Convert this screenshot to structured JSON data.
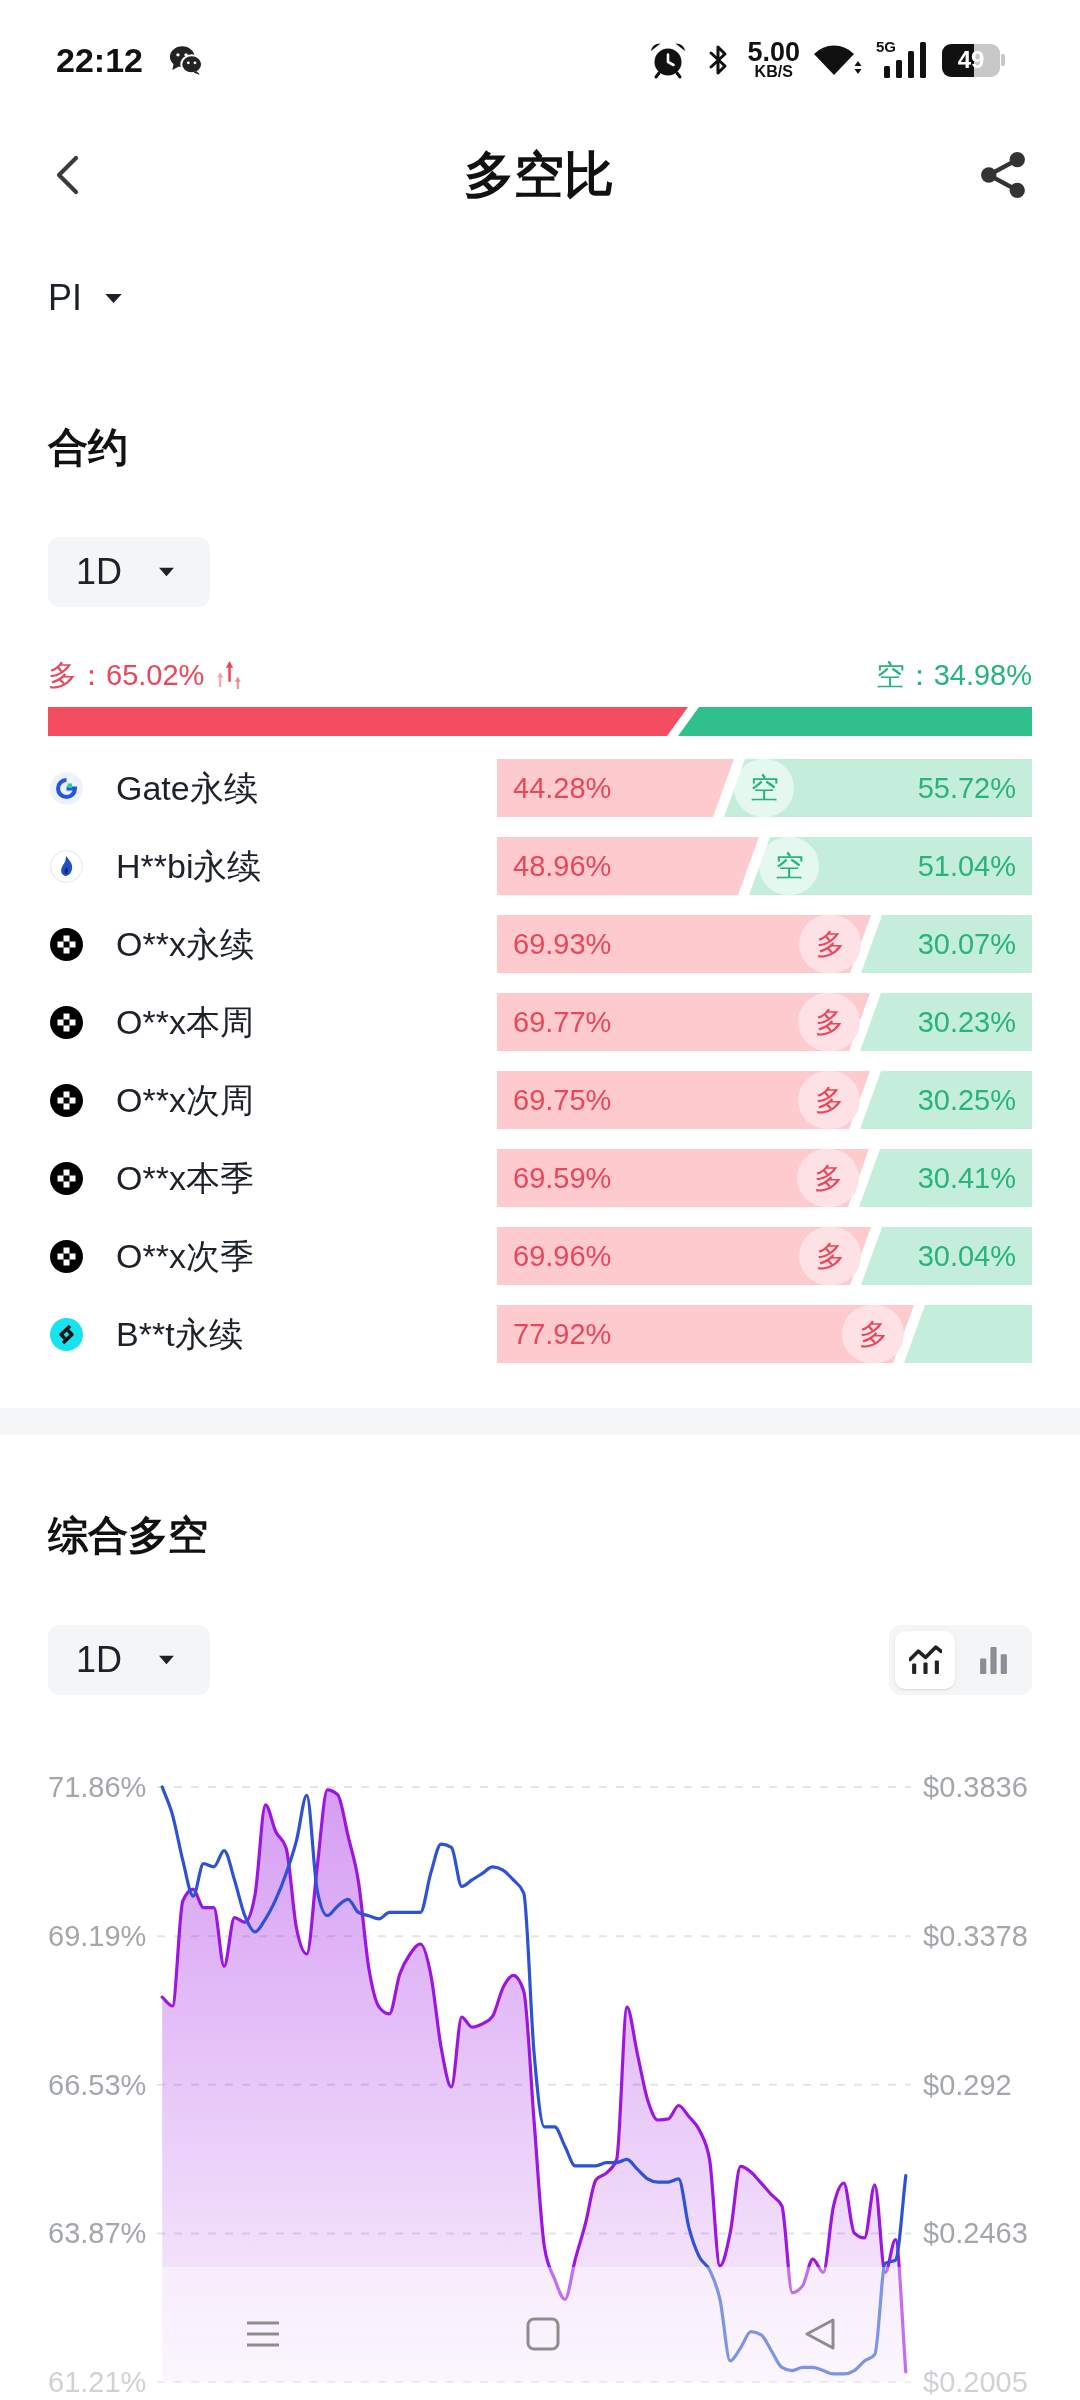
{
  "status_bar": {
    "time": "22:12",
    "network_speed": "5.00",
    "network_speed_unit": "KB/S",
    "network_type": "5G",
    "battery": "49"
  },
  "header": {
    "title": "多空比"
  },
  "symbol_selector": {
    "value": "PI"
  },
  "contracts": {
    "title": "合约",
    "period": "1D",
    "long_summary": "多：65.02%",
    "short_summary": "空：34.98%",
    "level": 0.6502,
    "exchanges": [
      {
        "kind": "ring",
        "name": "Gate永续",
        "long": "44.28%",
        "short": "55.72%",
        "level": 0.4428,
        "badge": "空"
      },
      {
        "kind": "flame",
        "name": "H**bi永续",
        "long": "48.96%",
        "short": "51.04%",
        "level": 0.4896,
        "badge": "空"
      },
      {
        "kind": "checker",
        "name": "O**x永续",
        "long": "69.93%",
        "short": "30.07%",
        "level": 0.6993,
        "badge": "多"
      },
      {
        "kind": "checker",
        "name": "O**x本周",
        "long": "69.77%",
        "short": "30.23%",
        "level": 0.6977,
        "badge": "多"
      },
      {
        "kind": "checker",
        "name": "O**x次周",
        "long": "69.75%",
        "short": "30.25%",
        "level": 0.6975,
        "badge": "多"
      },
      {
        "kind": "checker",
        "name": "O**x本季",
        "long": "69.59%",
        "short": "30.41%",
        "level": 0.6959,
        "badge": "多"
      },
      {
        "kind": "checker",
        "name": "O**x次季",
        "long": "69.96%",
        "short": "30.04%",
        "level": 0.6996,
        "badge": "多"
      },
      {
        "kind": "swirl",
        "name": "B**t永续",
        "long": "77.92%",
        "level": 0.7792,
        "badge": "多"
      }
    ]
  },
  "composite": {
    "title": "综合多空",
    "period": "1D",
    "chart_types": [
      {
        "kind": "line",
        "selected": true
      },
      {
        "kind": "bar",
        "selected": false
      }
    ],
    "chart_data": {
      "type": "line",
      "grid": true,
      "yticks": [
        {
          "value": 71.86,
          "label": "71.86%"
        },
        {
          "value": 69.19,
          "label": "69.19%"
        },
        {
          "value": 66.53,
          "label": "66.53%"
        },
        {
          "value": 63.87,
          "label": "63.87%"
        },
        {
          "value": 61.21,
          "label": "61.21%"
        }
      ],
      "ylim": [
        61.21,
        71.86
      ],
      "y2ticks": [
        {
          "value": 0.3836,
          "label": "$0.3836"
        },
        {
          "value": 0.3378,
          "label": "$0.3378"
        },
        {
          "value": 0.292,
          "label": "$0.292"
        },
        {
          "value": 0.2463,
          "label": "$0.2463"
        },
        {
          "value": 0.2005,
          "label": "$0.2005"
        }
      ],
      "y2lim": [
        0.2005,
        0.3836
      ],
      "series": [
        {
          "type": "area",
          "color": "#9c16e2",
          "values": [
            68.1,
            67.94,
            69.82,
            70.03,
            69.7,
            69.7,
            68.65,
            69.52,
            69.44,
            69.94,
            71.54,
            71.06,
            70.77,
            69.34,
            68.87,
            70.41,
            71.81,
            71.72,
            70.98,
            70.17,
            68.63,
            67.92,
            67.8,
            68.51,
            68.87,
            69.05,
            68.51,
            67.21,
            66.49,
            67.74,
            67.56,
            67.62,
            67.76,
            68.27,
            68.49,
            68.21,
            65.9,
            63.64,
            63.05,
            62.69,
            63.41,
            64.06,
            64.83,
            64.95,
            65.19,
            67.92,
            67.09,
            66.26,
            65.9,
            65.92,
            66.16,
            65.96,
            65.72,
            65.19,
            63.29,
            63.88,
            65.07,
            64.97,
            64.77,
            64.56,
            64.36,
            62.81,
            62.93,
            63.41,
            63.17,
            64.36,
            64.77,
            63.88,
            63.79,
            64.74,
            63.17,
            63.76,
            61.39
          ]
        },
        {
          "axis": "y2",
          "color": "#2d52d5",
          "values": [
            0.3836,
            0.375,
            0.361,
            0.35,
            0.36,
            0.359,
            0.364,
            0.355,
            0.344,
            0.339,
            0.343,
            0.349,
            0.357,
            0.367,
            0.381,
            0.352,
            0.344,
            0.347,
            0.349,
            0.345,
            0.344,
            0.343,
            0.345,
            0.345,
            0.345,
            0.345,
            0.357,
            0.366,
            0.365,
            0.353,
            0.355,
            0.357,
            0.359,
            0.358,
            0.355,
            0.351,
            0.302,
            0.279,
            0.279,
            0.273,
            0.267,
            0.267,
            0.267,
            0.268,
            0.268,
            0.269,
            0.266,
            0.263,
            0.262,
            0.262,
            0.263,
            0.248,
            0.239,
            0.235,
            0.226,
            0.207,
            0.211,
            0.216,
            0.215,
            0.21,
            0.205,
            0.204,
            0.205,
            0.205,
            0.204,
            0.203,
            0.203,
            0.204,
            0.207,
            0.209,
            0.237,
            0.238,
            0.264
          ]
        }
      ]
    }
  }
}
